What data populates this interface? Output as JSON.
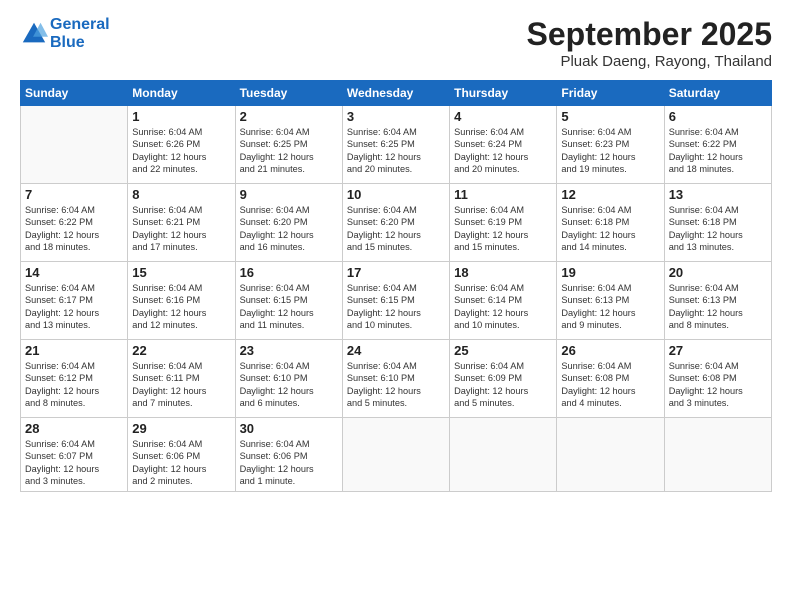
{
  "header": {
    "logo_line1": "General",
    "logo_line2": "Blue",
    "month_title": "September 2025",
    "subtitle": "Pluak Daeng, Rayong, Thailand"
  },
  "weekdays": [
    "Sunday",
    "Monday",
    "Tuesday",
    "Wednesday",
    "Thursday",
    "Friday",
    "Saturday"
  ],
  "weeks": [
    [
      {
        "day": "",
        "info": ""
      },
      {
        "day": "1",
        "info": "Sunrise: 6:04 AM\nSunset: 6:26 PM\nDaylight: 12 hours\nand 22 minutes."
      },
      {
        "day": "2",
        "info": "Sunrise: 6:04 AM\nSunset: 6:25 PM\nDaylight: 12 hours\nand 21 minutes."
      },
      {
        "day": "3",
        "info": "Sunrise: 6:04 AM\nSunset: 6:25 PM\nDaylight: 12 hours\nand 20 minutes."
      },
      {
        "day": "4",
        "info": "Sunrise: 6:04 AM\nSunset: 6:24 PM\nDaylight: 12 hours\nand 20 minutes."
      },
      {
        "day": "5",
        "info": "Sunrise: 6:04 AM\nSunset: 6:23 PM\nDaylight: 12 hours\nand 19 minutes."
      },
      {
        "day": "6",
        "info": "Sunrise: 6:04 AM\nSunset: 6:22 PM\nDaylight: 12 hours\nand 18 minutes."
      }
    ],
    [
      {
        "day": "7",
        "info": "Sunrise: 6:04 AM\nSunset: 6:22 PM\nDaylight: 12 hours\nand 18 minutes."
      },
      {
        "day": "8",
        "info": "Sunrise: 6:04 AM\nSunset: 6:21 PM\nDaylight: 12 hours\nand 17 minutes."
      },
      {
        "day": "9",
        "info": "Sunrise: 6:04 AM\nSunset: 6:20 PM\nDaylight: 12 hours\nand 16 minutes."
      },
      {
        "day": "10",
        "info": "Sunrise: 6:04 AM\nSunset: 6:20 PM\nDaylight: 12 hours\nand 15 minutes."
      },
      {
        "day": "11",
        "info": "Sunrise: 6:04 AM\nSunset: 6:19 PM\nDaylight: 12 hours\nand 15 minutes."
      },
      {
        "day": "12",
        "info": "Sunrise: 6:04 AM\nSunset: 6:18 PM\nDaylight: 12 hours\nand 14 minutes."
      },
      {
        "day": "13",
        "info": "Sunrise: 6:04 AM\nSunset: 6:18 PM\nDaylight: 12 hours\nand 13 minutes."
      }
    ],
    [
      {
        "day": "14",
        "info": "Sunrise: 6:04 AM\nSunset: 6:17 PM\nDaylight: 12 hours\nand 13 minutes."
      },
      {
        "day": "15",
        "info": "Sunrise: 6:04 AM\nSunset: 6:16 PM\nDaylight: 12 hours\nand 12 minutes."
      },
      {
        "day": "16",
        "info": "Sunrise: 6:04 AM\nSunset: 6:15 PM\nDaylight: 12 hours\nand 11 minutes."
      },
      {
        "day": "17",
        "info": "Sunrise: 6:04 AM\nSunset: 6:15 PM\nDaylight: 12 hours\nand 10 minutes."
      },
      {
        "day": "18",
        "info": "Sunrise: 6:04 AM\nSunset: 6:14 PM\nDaylight: 12 hours\nand 10 minutes."
      },
      {
        "day": "19",
        "info": "Sunrise: 6:04 AM\nSunset: 6:13 PM\nDaylight: 12 hours\nand 9 minutes."
      },
      {
        "day": "20",
        "info": "Sunrise: 6:04 AM\nSunset: 6:13 PM\nDaylight: 12 hours\nand 8 minutes."
      }
    ],
    [
      {
        "day": "21",
        "info": "Sunrise: 6:04 AM\nSunset: 6:12 PM\nDaylight: 12 hours\nand 8 minutes."
      },
      {
        "day": "22",
        "info": "Sunrise: 6:04 AM\nSunset: 6:11 PM\nDaylight: 12 hours\nand 7 minutes."
      },
      {
        "day": "23",
        "info": "Sunrise: 6:04 AM\nSunset: 6:10 PM\nDaylight: 12 hours\nand 6 minutes."
      },
      {
        "day": "24",
        "info": "Sunrise: 6:04 AM\nSunset: 6:10 PM\nDaylight: 12 hours\nand 5 minutes."
      },
      {
        "day": "25",
        "info": "Sunrise: 6:04 AM\nSunset: 6:09 PM\nDaylight: 12 hours\nand 5 minutes."
      },
      {
        "day": "26",
        "info": "Sunrise: 6:04 AM\nSunset: 6:08 PM\nDaylight: 12 hours\nand 4 minutes."
      },
      {
        "day": "27",
        "info": "Sunrise: 6:04 AM\nSunset: 6:08 PM\nDaylight: 12 hours\nand 3 minutes."
      }
    ],
    [
      {
        "day": "28",
        "info": "Sunrise: 6:04 AM\nSunset: 6:07 PM\nDaylight: 12 hours\nand 3 minutes."
      },
      {
        "day": "29",
        "info": "Sunrise: 6:04 AM\nSunset: 6:06 PM\nDaylight: 12 hours\nand 2 minutes."
      },
      {
        "day": "30",
        "info": "Sunrise: 6:04 AM\nSunset: 6:06 PM\nDaylight: 12 hours\nand 1 minute."
      },
      {
        "day": "",
        "info": ""
      },
      {
        "day": "",
        "info": ""
      },
      {
        "day": "",
        "info": ""
      },
      {
        "day": "",
        "info": ""
      }
    ]
  ]
}
